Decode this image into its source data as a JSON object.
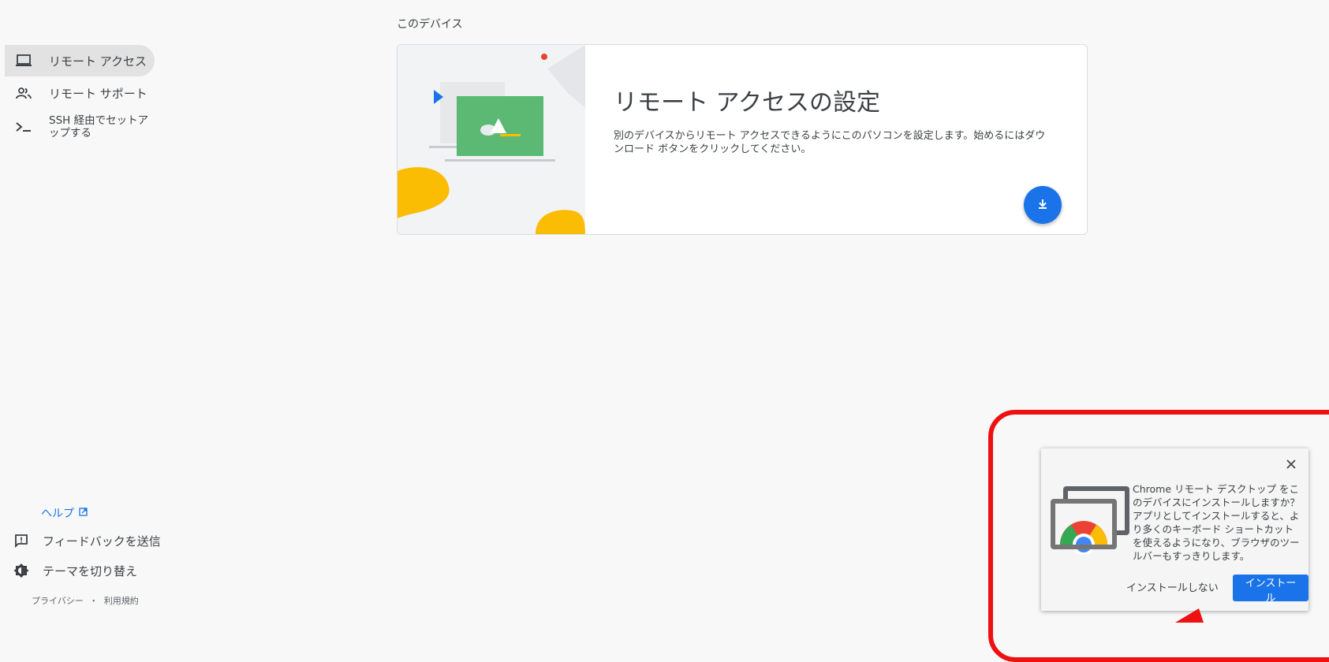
{
  "section_title": "このデバイス",
  "sidebar": {
    "items": [
      {
        "label": "リモート アクセス",
        "icon": "laptop-icon",
        "active": true
      },
      {
        "label": "リモート サポート",
        "icon": "people-icon",
        "active": false
      },
      {
        "label": "SSH 経由でセットア\nップする",
        "icon": "terminal-icon",
        "active": false
      }
    ],
    "help": "ヘルプ",
    "feedback": "フィードバックを送信",
    "theme": "テーマを切り替え",
    "privacy": "プライバシー",
    "separator": "・",
    "terms": "利用規約"
  },
  "card": {
    "title": "リモート アクセスの設定",
    "description": "別のデバイスからリモート アクセスできるようにこのパソコンを設定します。始めるにはダウンロード ボタンをクリックしてください。"
  },
  "install_popup": {
    "message": "Chrome リモート デスクトップ をこのデバイスにインストールしますか？ アプリとしてインストールすると、より多くのキーボード ショートカットを使えるようになり、ブラウザのツールバーもすっきりします。",
    "cancel_label": "インストールしない",
    "install_label": "インストール"
  },
  "colors": {
    "accent": "#1a73e8",
    "highlight": "#ee1111",
    "illustration_green": "#5bb974",
    "illustration_yellow": "#fbbc04"
  }
}
